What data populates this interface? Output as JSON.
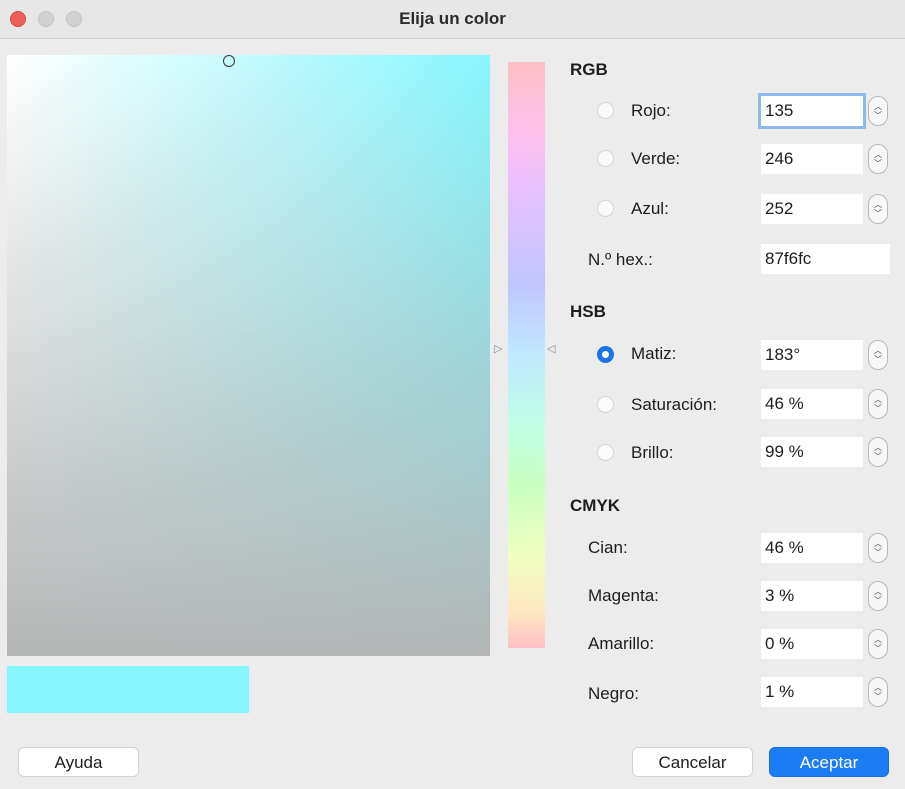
{
  "window": {
    "title": "Elija un color"
  },
  "picker": {
    "current_hex": "#87f6fc"
  },
  "rgb": {
    "header": "RGB",
    "red": {
      "label": "Rojo:",
      "value": "135",
      "selected": false
    },
    "green": {
      "label": "Verde:",
      "value": "246",
      "selected": false
    },
    "blue": {
      "label": "Azul:",
      "value": "252",
      "selected": false
    },
    "hex": {
      "label": "N.º hex.:",
      "value": "87f6fc"
    }
  },
  "hsb": {
    "header": "HSB",
    "hue": {
      "label": "Matiz:",
      "value": "183°",
      "selected": true
    },
    "saturation": {
      "label": "Saturación:",
      "value": "46 %",
      "selected": false
    },
    "brightness": {
      "label": "Brillo:",
      "value": "99 %",
      "selected": false
    }
  },
  "cmyk": {
    "header": "CMYK",
    "cyan": {
      "label": "Cian:",
      "value": "46 %"
    },
    "magenta": {
      "label": "Magenta:",
      "value": "3 %"
    },
    "yellow": {
      "label": "Amarillo:",
      "value": "0 %"
    },
    "black": {
      "label": "Negro:",
      "value": "1 %"
    }
  },
  "buttons": {
    "help": "Ayuda",
    "cancel": "Cancelar",
    "accept": "Aceptar"
  },
  "colors": {
    "accent": "#1c7cf4",
    "close": "#ee5f57"
  }
}
